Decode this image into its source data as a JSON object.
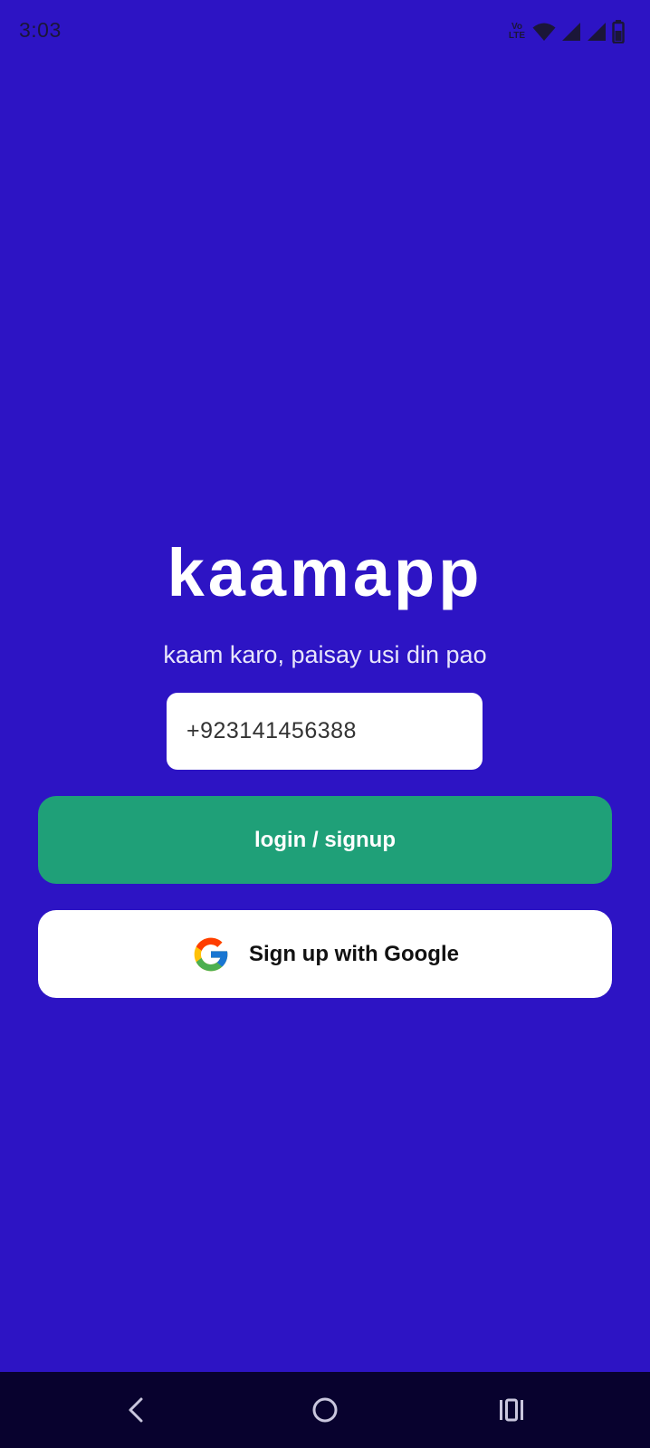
{
  "status_bar": {
    "time": "3:03",
    "volte_line1": "Vo",
    "volte_line2": "LTE",
    "icons": [
      "volte-lte-icon",
      "wifi-icon",
      "signal-icon",
      "signal-icon",
      "battery-icon"
    ]
  },
  "app": {
    "title": "kaamapp",
    "tagline": "kaam karo, paisay usi din pao"
  },
  "form": {
    "phone_value": "+923141456388",
    "login_label": "login / signup",
    "google_label": "Sign up with Google"
  },
  "nav": {
    "icons": [
      "back-icon",
      "home-icon",
      "recents-icon"
    ]
  },
  "colors": {
    "background": "#2D14C4",
    "primary_button": "#1FA078",
    "nav_bar": "#08022E",
    "google_blue": "#4285F4",
    "google_red": "#EA4335",
    "google_yellow": "#FBBC05",
    "google_green": "#34A853"
  }
}
